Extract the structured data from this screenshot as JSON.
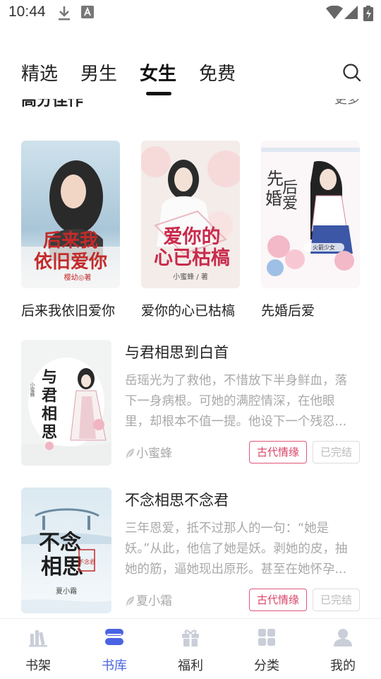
{
  "status_bar": {
    "time": "10:44"
  },
  "tabs": [
    {
      "label": "精选"
    },
    {
      "label": "男生"
    },
    {
      "label": "女生",
      "active": true
    },
    {
      "label": "免费"
    }
  ],
  "section": {
    "title": "高分佳作",
    "more": "更多"
  },
  "grid_books": [
    {
      "title": "后来我依旧爱你",
      "cover_text": "后来我依旧爱你",
      "cover_author": "樱幼◎著"
    },
    {
      "title": "爱你的心已枯槁",
      "cover_text": "爱你的心已枯槁",
      "cover_author": "小蜜蜂 / 著"
    },
    {
      "title": "先婚后爱",
      "cover_text": "先婚后爱",
      "cover_author": "火箭少女"
    }
  ],
  "list_books": [
    {
      "title": "与君相思到白首",
      "description": "岳瑶光为了救他，不惜放下半身鲜血，落下一身病根。可她的满腔情深，在他眼里，却根本不值一提。他设下一个残忍...",
      "author": "小蜜蜂",
      "genre": "古代情缘",
      "status": "已完结",
      "cover_text": "与君相思",
      "cover_author": "小蜜蜂"
    },
    {
      "title": "不念相思不念君",
      "description": "三年恩爱，抵不过那人的一句：“她是妖。”从此，他信了她是妖。剥她的皮，抽她的筋，逼她现出原形。甚至在她怀孕...",
      "author": "夏小霜",
      "genre": "古代情缘",
      "status": "已完结",
      "cover_text": "不念相思",
      "cover_author": "夏小霜"
    }
  ],
  "bottom_nav": [
    {
      "label": "书架",
      "icon": "bookshelf-icon"
    },
    {
      "label": "书库",
      "icon": "library-icon",
      "active": true
    },
    {
      "label": "福利",
      "icon": "gift-icon"
    },
    {
      "label": "分类",
      "icon": "category-icon"
    },
    {
      "label": "我的",
      "icon": "profile-icon"
    }
  ],
  "colors": {
    "accent": "#4a64e3",
    "tag": "#d94366"
  }
}
